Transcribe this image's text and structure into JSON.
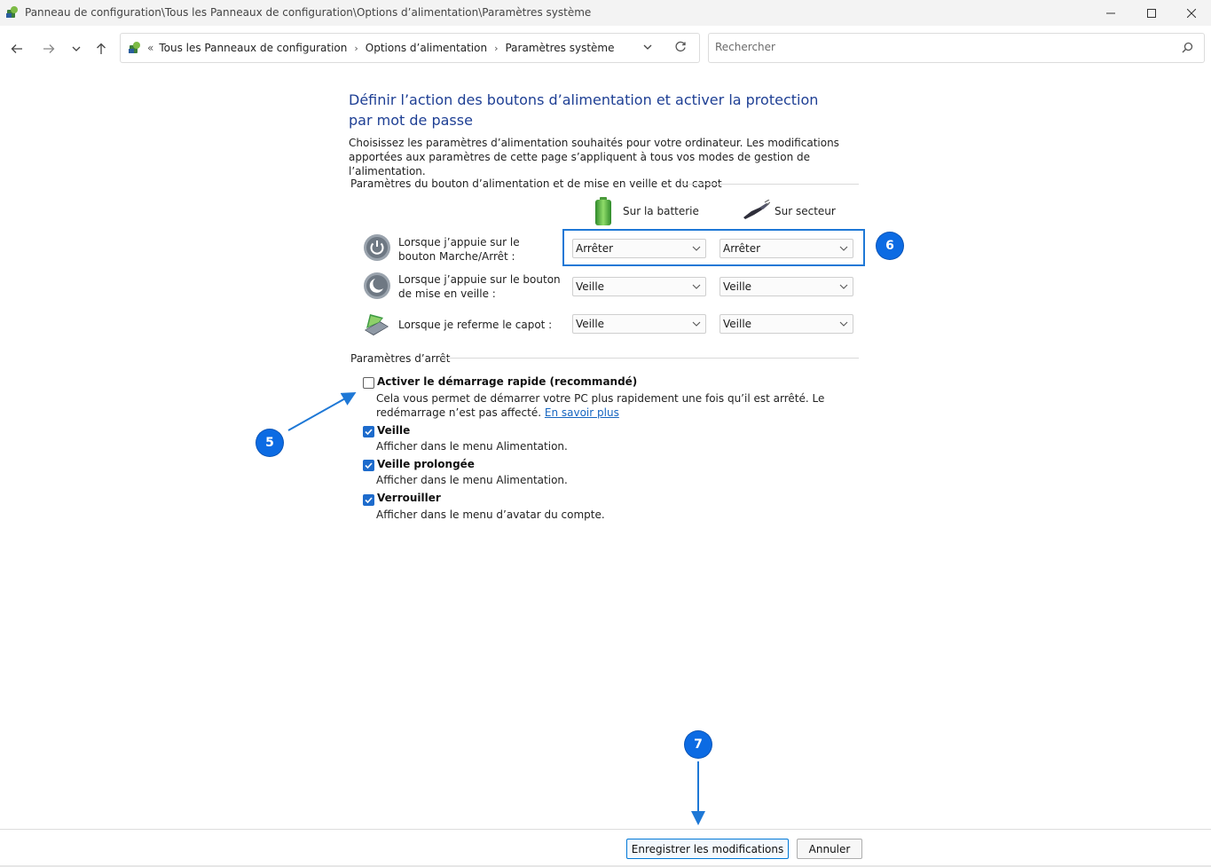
{
  "window": {
    "title": "Panneau de configuration\\Tous les Panneaux de configuration\\Options d’alimentation\\Paramètres système",
    "icon": "control-panel-icon",
    "controls": {
      "minimize": "minimize-icon",
      "maximize": "maximize-icon",
      "close": "close-icon"
    }
  },
  "nav": {
    "back": "arrow-left-icon",
    "forward": "arrow-right-icon",
    "recent": "chevron-down-icon",
    "up": "arrow-up-icon",
    "address": {
      "overflow": "«",
      "crumbs": [
        "Tous les Panneaux de configuration",
        "Options d’alimentation",
        "Paramètres système"
      ],
      "separator": "›"
    },
    "search": {
      "placeholder": "Rechercher"
    }
  },
  "main": {
    "heading": "Définir l’action des boutons d’alimentation et activer la protection par mot de passe",
    "intro": "Choisissez les paramètres d’alimentation souhaités pour votre ordinateur. Les modifications apportées aux paramètres de cette page s’appliquent à tous vos modes de gestion de l’alimentation.",
    "power_group": {
      "header": "Paramètres du bouton d’alimentation et de mise en veille et du capot",
      "columns": {
        "battery": "Sur la batterie",
        "plugged": "Sur secteur"
      },
      "rows": [
        {
          "label": "Lorsque j’appuie sur le bouton Marche/Arrêt :",
          "battery": "Arrêter",
          "plugged": "Arrêter"
        },
        {
          "label": "Lorsque j’appuie sur le bouton de mise en veille :",
          "battery": "Veille",
          "plugged": "Veille"
        },
        {
          "label": "Lorsque je referme le capot :",
          "battery": "Veille",
          "plugged": "Veille"
        }
      ]
    },
    "shutdown_group": {
      "header": "Paramètres d’arrêt",
      "options": [
        {
          "title": "Activer le démarrage rapide (recommandé)",
          "desc": "Cela vous permet de démarrer votre PC plus rapidement une fois qu’il est arrêté. Le redémarrage n’est pas affecté.",
          "link": "En savoir plus",
          "checked": false
        },
        {
          "title": "Veille",
          "desc": "Afficher dans le menu Alimentation.",
          "checked": true
        },
        {
          "title": "Veille prolongée",
          "desc": "Afficher dans le menu Alimentation.",
          "checked": true
        },
        {
          "title": "Verrouiller",
          "desc": "Afficher dans le menu d’avatar du compte.",
          "checked": true
        }
      ]
    }
  },
  "footer": {
    "save": "Enregistrer les modifications",
    "cancel": "Annuler"
  },
  "annotations": {
    "badge5": "5",
    "badge6": "6",
    "badge7": "7"
  },
  "colors": {
    "accent": "#0c6be3",
    "heading": "#1e3f94",
    "link": "#1565c0",
    "checkbox": "#1d6bcc"
  }
}
